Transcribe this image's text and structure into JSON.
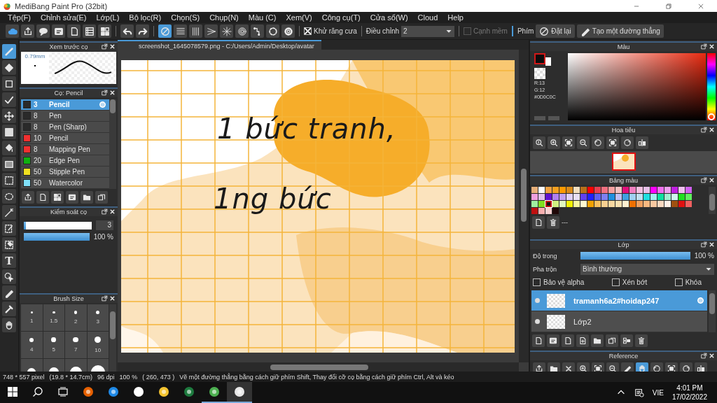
{
  "window": {
    "title": "MediBang Paint Pro (32bit)"
  },
  "menu": [
    "Tệp(F)",
    "Chỉnh sửa(E)",
    "Lớp(L)",
    "Bộ lọc(R)",
    "Chọn(S)",
    "Chụp(N)",
    "Màu (C)",
    "Xem(V)",
    "Công cụ(T)",
    "Cửa sổ(W)",
    "Cloud",
    "Help"
  ],
  "toolbar": {
    "ruler_buttons": [
      {
        "selected": true
      },
      {
        "selected": false
      },
      {
        "selected": false
      },
      {
        "selected": false
      },
      {
        "selected": false
      },
      {
        "selected": false
      },
      {
        "selected": false
      },
      {
        "selected": false
      },
      {
        "selected": false
      }
    ],
    "antialias": {
      "label": "Khử răng cưa",
      "checked": true
    },
    "correction": {
      "label": "Điều chỉnh",
      "value": "2"
    },
    "soft_edge": {
      "label": "Cạnh mềm",
      "checked": false,
      "disabled": true
    },
    "keys_label": "Phím",
    "buttons": [
      "Đặt lại",
      "Tạo một đường thẳng"
    ]
  },
  "tools": [
    {
      "selected": true
    },
    {
      "selected": false
    },
    {
      "selected": false
    },
    {
      "selected": false
    },
    {
      "selected": false
    },
    {
      "selected": false
    },
    {
      "selected": false
    },
    {
      "selected": false
    },
    {
      "selected": false
    },
    {
      "selected": false
    },
    {
      "selected": false
    },
    {
      "selected": false
    },
    {
      "selected": false
    },
    {
      "selected": false,
      "label": "T"
    },
    {
      "selected": false
    },
    {
      "selected": false
    },
    {
      "selected": false
    },
    {
      "selected": false
    }
  ],
  "brush_preview": {
    "title": "Xem trước cọ",
    "size": "0.79mm"
  },
  "brush_panel": {
    "title": "Cọ: Pencil",
    "brushes": [
      {
        "size": "3",
        "name": "Pencil",
        "color": "#2a2a2a",
        "selected": true
      },
      {
        "size": "8",
        "name": "Pen",
        "color": "#2a2a2a",
        "selected": false
      },
      {
        "size": "8",
        "name": "Pen (Sharp)",
        "color": "#2a2a2a",
        "selected": false
      },
      {
        "size": "10",
        "name": "Pencil",
        "color": "#f03030",
        "selected": false
      },
      {
        "size": "8",
        "name": "Mapping Pen",
        "color": "#f03030",
        "selected": false
      },
      {
        "size": "20",
        "name": "Edge Pen",
        "color": "#10b010",
        "selected": false
      },
      {
        "size": "50",
        "name": "Stipple Pen",
        "color": "#f0e020",
        "selected": false
      },
      {
        "size": "50",
        "name": "Watercolor",
        "color": "#80e0f8",
        "selected": false
      }
    ]
  },
  "brush_control": {
    "title": "Kiểm soát cọ",
    "size": {
      "level": 0.03,
      "value": "3"
    },
    "opacity": {
      "level": 1,
      "value": "100 %"
    }
  },
  "brush_size": {
    "title": "Brush Size",
    "sizes": [
      "1",
      "1.5",
      "2",
      "3",
      "4",
      "5",
      "7",
      "10"
    ]
  },
  "document_tab": {
    "title": "screenshot_1645078579.png - C:/Users/Admin/Desktop/avatar"
  },
  "canvas": {
    "text_lines": [
      "1 bức tranh,",
      "1ng bức"
    ]
  },
  "color_panel": {
    "title": "Màu",
    "r": "R:13",
    "g": "G:12",
    "hex": "#0D0C0C"
  },
  "navigator": {
    "title": "Hoa tiêu"
  },
  "palette_panel": {
    "title": "Bảng màu",
    "name": "---",
    "swatches": [
      {
        "color": "#e8b07a",
        "selected": false
      },
      {
        "color": "#ffffff",
        "selected": false
      },
      {
        "color": "#f0a040",
        "selected": false
      },
      {
        "color": "#f5a020",
        "selected": false
      },
      {
        "color": "#ff9900",
        "selected": false
      },
      {
        "color": "#d98a1a",
        "selected": false
      },
      {
        "color": "#f5e0c0",
        "selected": false
      },
      {
        "color": "#b8701a",
        "selected": false
      },
      {
        "color": "#ff0000",
        "selected": false
      },
      {
        "color": "#e84050",
        "selected": false
      },
      {
        "color": "#f07080",
        "selected": false
      },
      {
        "color": "#f5a0a0",
        "selected": false
      },
      {
        "color": "#f5c0c0",
        "selected": false
      },
      {
        "color": "#e0107a",
        "selected": false
      },
      {
        "color": "#f080c0",
        "selected": false
      },
      {
        "color": "#f5c0e0",
        "selected": false
      },
      {
        "color": "#e8c0e8",
        "selected": false
      },
      {
        "color": "#ff00ff",
        "selected": false
      },
      {
        "color": "#f070f0",
        "selected": false
      },
      {
        "color": "#f0a0f0",
        "selected": false
      },
      {
        "color": "#c020e0",
        "selected": false
      },
      {
        "color": "#f0c0f0",
        "selected": false
      },
      {
        "color": "#d060f0",
        "selected": false
      },
      {
        "color": "#f0a0e0",
        "selected": false
      },
      {
        "color": "#e0c0f0",
        "selected": false
      },
      {
        "color": "#6010d0",
        "selected": false
      },
      {
        "color": "#b080f0",
        "selected": false
      },
      {
        "color": "#c0a0f0",
        "selected": false
      },
      {
        "color": "#e0d0f8",
        "selected": false
      },
      {
        "color": "#e8e0f8",
        "selected": false
      },
      {
        "color": "#6040f0",
        "selected": false
      },
      {
        "color": "#2020ff",
        "selected": false
      },
      {
        "color": "#6060f0",
        "selected": false
      },
      {
        "color": "#8080f0",
        "selected": false
      },
      {
        "color": "#2090e0",
        "selected": false
      },
      {
        "color": "#c0c0f8",
        "selected": false
      },
      {
        "color": "#40a0e0",
        "selected": false
      },
      {
        "color": "#a0d0f0",
        "selected": false
      },
      {
        "color": "#c0e0f0",
        "selected": false
      },
      {
        "color": "#20e0e0",
        "selected": false
      },
      {
        "color": "#a0f0f0",
        "selected": false
      },
      {
        "color": "#10e0a0",
        "selected": false
      },
      {
        "color": "#a0f0d0",
        "selected": false
      },
      {
        "color": "#d0f8f0",
        "selected": false
      },
      {
        "color": "#20e020",
        "selected": false
      },
      {
        "color": "#60f060",
        "selected": false
      },
      {
        "color": "#a0f0a0",
        "selected": false
      },
      {
        "color": "#80e020",
        "selected": false
      },
      {
        "color": "#101010",
        "selected": true
      },
      {
        "color": "#d0f080",
        "selected": false
      },
      {
        "color": "#e0f8c0",
        "selected": false
      },
      {
        "color": "#f0f000",
        "selected": false
      },
      {
        "color": "#f8f8a0",
        "selected": false
      },
      {
        "color": "#fff8d0",
        "selected": false
      },
      {
        "color": "#f0a000",
        "selected": false
      },
      {
        "color": "#f8c060",
        "selected": false
      },
      {
        "color": "#f8d090",
        "selected": false
      },
      {
        "color": "#f8d8a0",
        "selected": false
      },
      {
        "color": "#f8e0b0",
        "selected": false
      },
      {
        "color": "#fff0d0",
        "selected": false
      },
      {
        "color": "#f07000",
        "selected": false
      },
      {
        "color": "#f0a060",
        "selected": false
      },
      {
        "color": "#f8b880",
        "selected": false
      },
      {
        "color": "#f8c8a0",
        "selected": false
      },
      {
        "color": "#f8d8c0",
        "selected": false
      },
      {
        "color": "#fff0e8",
        "selected": false
      },
      {
        "color": "#a05010",
        "selected": false
      },
      {
        "color": "#e01010",
        "selected": false
      },
      {
        "color": "#f06060",
        "selected": false
      },
      {
        "color": "#c01010",
        "selected": false
      },
      {
        "color": "#f8b0b0",
        "selected": false
      },
      {
        "color": "#f8d0d0",
        "selected": false
      },
      {
        "color": "#200808",
        "selected": false
      }
    ]
  },
  "layer_panel": {
    "title": "Lớp",
    "opacity_label": "Độ trong",
    "opacity": {
      "level": 1,
      "value": "100 %"
    },
    "blend_label": "Pha trộn",
    "blend_value": "Bình thường",
    "options": [
      {
        "label": "Bảo vệ alpha",
        "checked": false
      },
      {
        "label": "Xén bớt",
        "checked": false
      },
      {
        "label": "Khóa",
        "checked": false
      }
    ],
    "layers": [
      {
        "name": "tramanh6a2#hoidap247",
        "selected": true
      },
      {
        "name": "Lớp2",
        "selected": false
      }
    ]
  },
  "reference_panel": {
    "title": "Reference",
    "tools": [
      {
        "selected": false
      },
      {
        "selected": false
      },
      {
        "selected": false
      },
      {
        "selected": false
      },
      {
        "selected": false
      },
      {
        "selected": false
      },
      {
        "selected": false
      },
      {
        "selected": true
      },
      {
        "selected": false
      },
      {
        "selected": false
      },
      {
        "selected": false
      },
      {
        "selected": false
      }
    ]
  },
  "status_bar": {
    "size": "748 * 557 pixel",
    "physical": "(19.8 * 14.7cm)",
    "dpi": "96 dpi",
    "zoom": "100 %",
    "cursor": "( 260, 473 )",
    "hint": "Vẽ một đường thẳng bằng cách giữ phím Shift, Thay đổi cỡ cọ bằng cách giữ phím Ctrl, Alt và kéo"
  },
  "taskbar": {
    "apps": [
      {
        "running": false,
        "selected": false
      },
      {
        "running": false,
        "selected": false
      },
      {
        "running": false,
        "selected": false
      },
      {
        "running": false,
        "selected": false
      },
      {
        "running": false,
        "selected": false
      },
      {
        "running": true,
        "selected": false
      },
      {
        "running": true,
        "selected": true
      }
    ],
    "language": "VIE",
    "time": "4:01 PM",
    "date": "17/02/2022"
  }
}
